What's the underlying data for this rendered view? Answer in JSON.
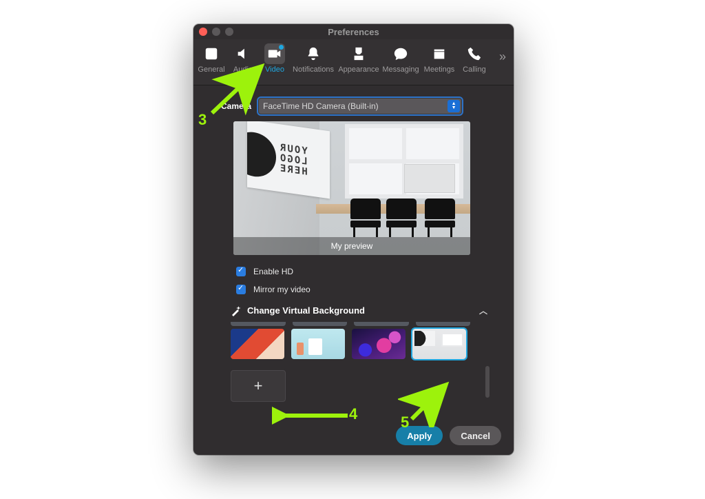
{
  "window": {
    "title": "Preferences"
  },
  "toolbar": {
    "items": [
      {
        "id": "general",
        "label": "General"
      },
      {
        "id": "audio",
        "label": "Audio"
      },
      {
        "id": "video",
        "label": "Video",
        "selected": true,
        "badge": true
      },
      {
        "id": "notifications",
        "label": "Notifications"
      },
      {
        "id": "appearance",
        "label": "Appearance"
      },
      {
        "id": "messaging",
        "label": "Messaging"
      },
      {
        "id": "meetings",
        "label": "Meetings"
      },
      {
        "id": "calling",
        "label": "Calling"
      }
    ],
    "overflow_glyph": "»"
  },
  "camera": {
    "label": "Camera",
    "selected": "FaceTime HD Camera (Built-in)"
  },
  "preview": {
    "caption": "My preview",
    "logo_text": "YOUR\nLOGO\nHERE"
  },
  "checks": {
    "enable_hd": {
      "label": "Enable HD",
      "checked": true
    },
    "mirror": {
      "label": "Mirror my video",
      "checked": true
    }
  },
  "virtual_bg": {
    "header": "Change Virtual Background",
    "add_label": "+",
    "selected_index": 3
  },
  "footer": {
    "apply": "Apply",
    "cancel": "Cancel"
  },
  "annotations": {
    "step3": "3",
    "step4": "4",
    "step5": "5"
  }
}
